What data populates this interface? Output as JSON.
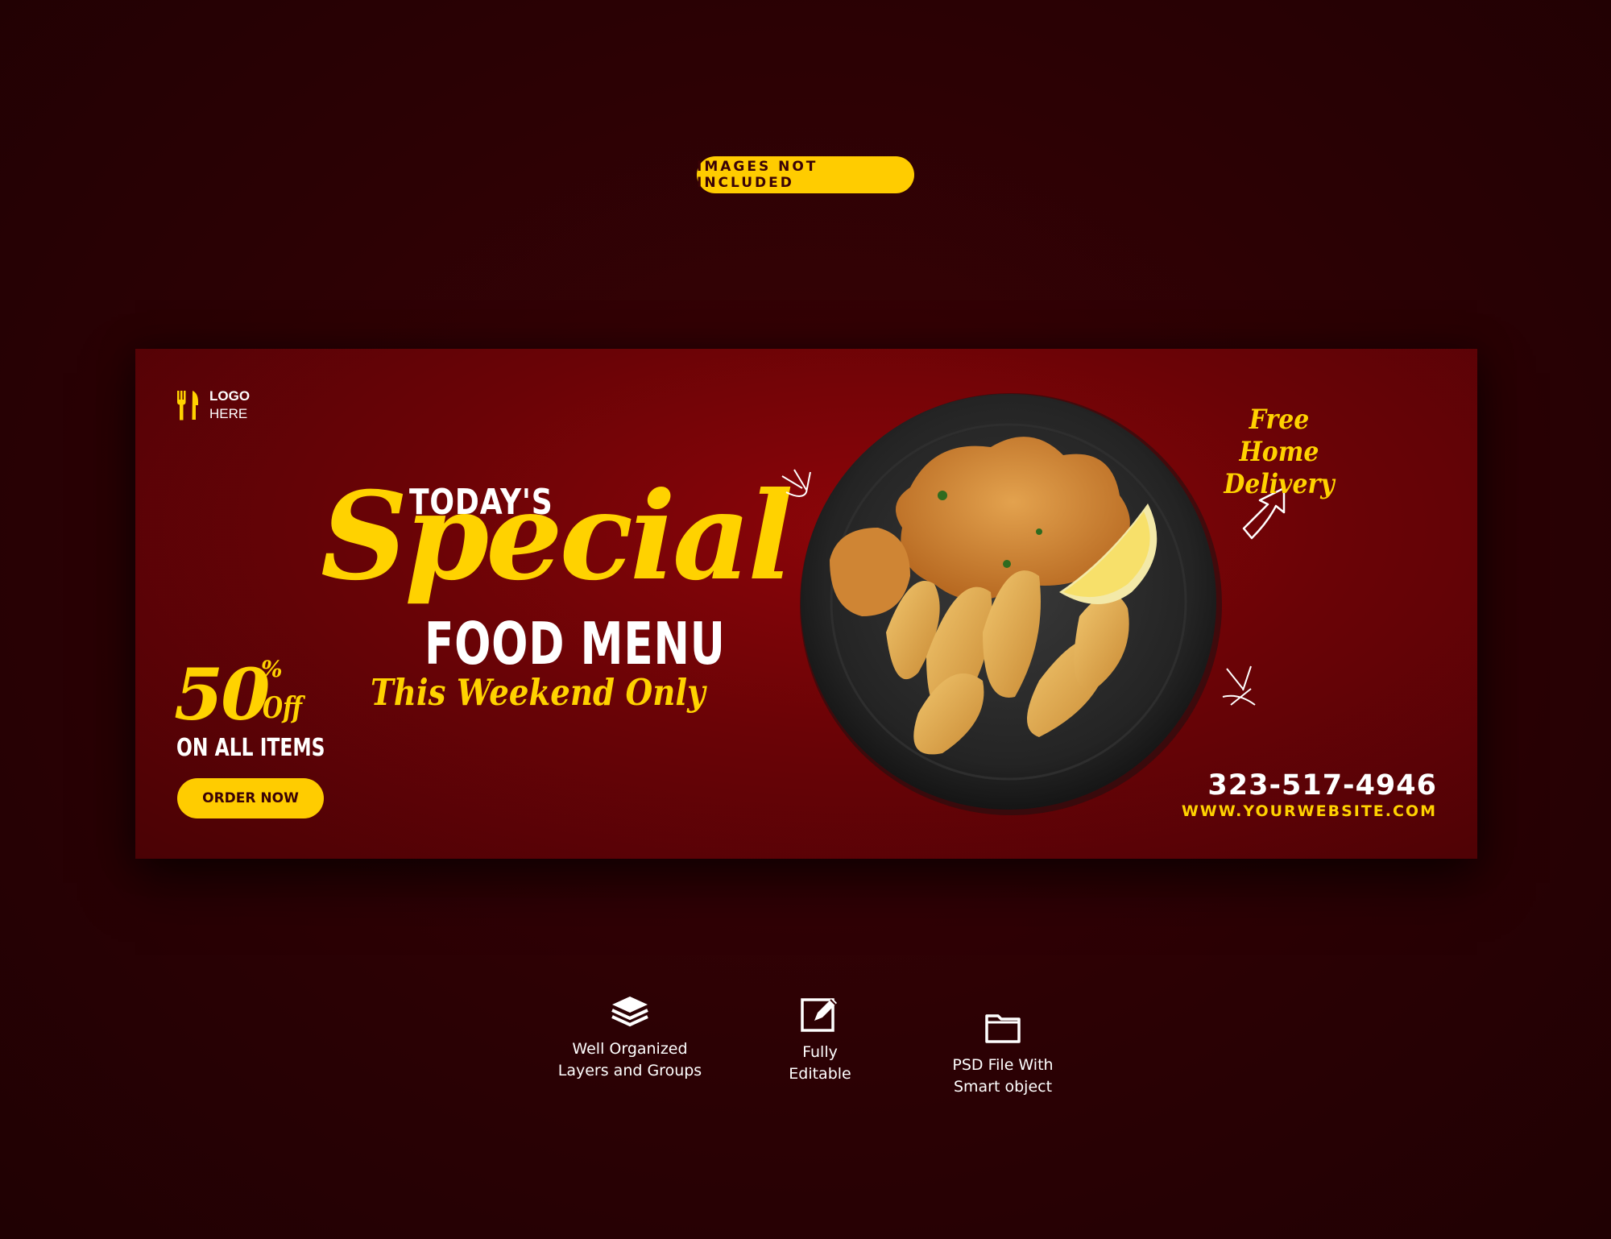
{
  "badge": {
    "label": "IMAGES NOT INCLUDED"
  },
  "banner": {
    "logo": {
      "line1": "LOGO",
      "line2": "HERE"
    },
    "headline": {
      "todays": "TODAY'S",
      "special": "Special",
      "food_menu": "FOOD MENU",
      "weekend": "This Weekend Only"
    },
    "discount": {
      "number": "50",
      "percent": "%",
      "off": "Off",
      "all_items": "ON ALL ITEMS"
    },
    "order_button": "ORDER NOW",
    "delivery": {
      "line1": "Free Home",
      "line2": "Delivery"
    },
    "phone": "323-517-4946",
    "website": "WWW.YOURWEBSITE.COM"
  },
  "features": [
    {
      "icon": "layers-icon",
      "line1": "Well Organized",
      "line2": "Layers and Groups"
    },
    {
      "icon": "edit-icon",
      "line1": "Fully",
      "line2": "Editable"
    },
    {
      "icon": "folder-icon",
      "line1": "PSD File With",
      "line2": "Smart object"
    }
  ],
  "colors": {
    "background": "#2a0104",
    "banner": "#7a0407",
    "accent_yellow": "#ffd200",
    "text_white": "#ffffff"
  }
}
